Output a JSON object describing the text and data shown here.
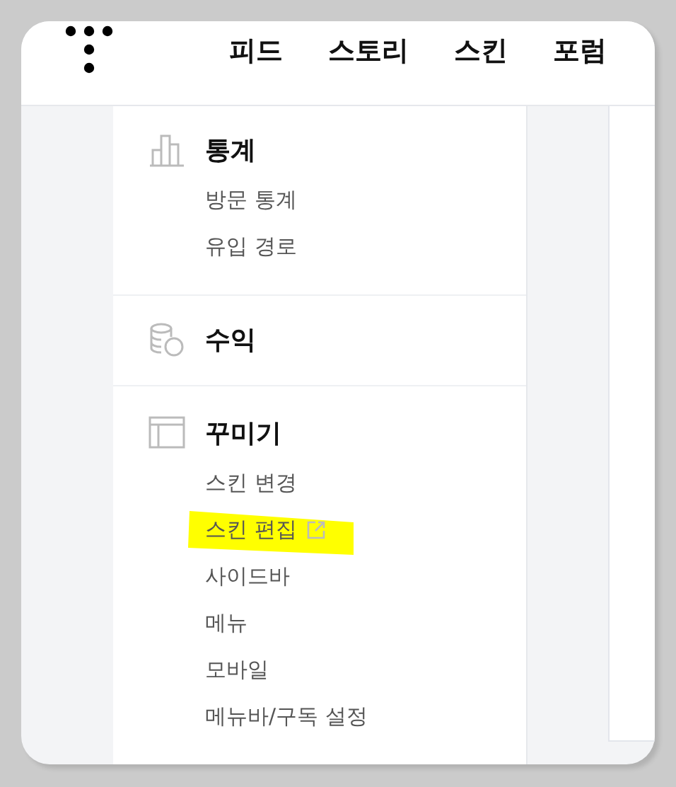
{
  "nav": [
    {
      "label": "피드"
    },
    {
      "label": "스토리"
    },
    {
      "label": "스킨"
    },
    {
      "label": "포럼"
    }
  ],
  "sidebar": {
    "sections": [
      {
        "kind": "stats",
        "title": "통계",
        "items": [
          {
            "label": "방문 통계",
            "external": false,
            "highlighted": false
          },
          {
            "label": "유입 경로",
            "external": false,
            "highlighted": false
          }
        ]
      },
      {
        "kind": "revenue",
        "title": "수익"
      },
      {
        "kind": "design",
        "title": "꾸미기",
        "items": [
          {
            "label": "스킨 변경",
            "external": false,
            "highlighted": false
          },
          {
            "label": "스킨 편집",
            "external": true,
            "highlighted": true
          },
          {
            "label": "사이드바",
            "external": false,
            "highlighted": false
          },
          {
            "label": "메뉴",
            "external": false,
            "highlighted": false
          },
          {
            "label": "모바일",
            "external": false,
            "highlighted": false
          },
          {
            "label": "메뉴바/구독 설정",
            "external": false,
            "highlighted": false
          }
        ]
      }
    ]
  }
}
